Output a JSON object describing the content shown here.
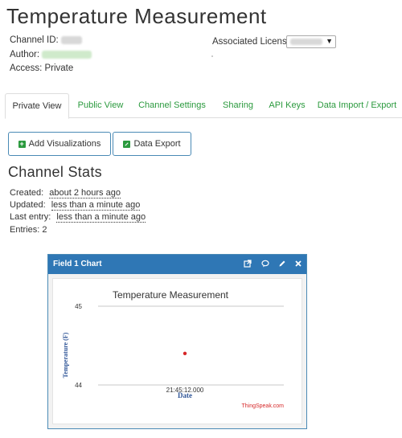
{
  "page": {
    "title": "Temperature Measurement"
  },
  "channel": {
    "id_label": "Channel ID:",
    "author_label": "Author:",
    "access_label": "Access:",
    "access_value": "Private",
    "license_label": "Associated License:"
  },
  "tabs": [
    {
      "label": "Private View",
      "active": true
    },
    {
      "label": "Public View",
      "active": false
    },
    {
      "label": "Channel Settings",
      "active": false
    },
    {
      "label": "Sharing",
      "active": false
    },
    {
      "label": "API Keys",
      "active": false
    },
    {
      "label": "Data Import / Export",
      "active": false
    }
  ],
  "buttons": {
    "add_visualizations": "Add Visualizations",
    "data_export": "Data Export"
  },
  "stats": {
    "title": "Channel Stats",
    "created_label": "Created:",
    "created_value": "about 2 hours ago",
    "updated_label": "Updated:",
    "updated_value": "less than a minute ago",
    "last_entry_label": "Last entry:",
    "last_entry_value": "less than a minute ago",
    "entries_label": "Entries:",
    "entries_value": "2"
  },
  "chart_panel": {
    "header": "Field 1 Chart",
    "icons": [
      "external-link-icon",
      "comment-icon",
      "pencil-icon",
      "close-icon"
    ]
  },
  "chart_data": {
    "type": "scatter",
    "title": "Temperature Measurement",
    "xlabel": "Date",
    "ylabel": "Temperature (F)",
    "x_ticks": [
      "21:45:12.000"
    ],
    "y_ticks": [
      44,
      45
    ],
    "ylim": [
      44,
      45
    ],
    "points": [
      {
        "x": "21:45:12.000",
        "y": 44.4
      }
    ],
    "point_color": "#d62728",
    "credit": "ThingSpeak.com",
    "credit_color": "#d62728",
    "grid": true
  },
  "colors": {
    "accent_green": "#2b9a3e",
    "header_blue": "#2f77b5"
  }
}
